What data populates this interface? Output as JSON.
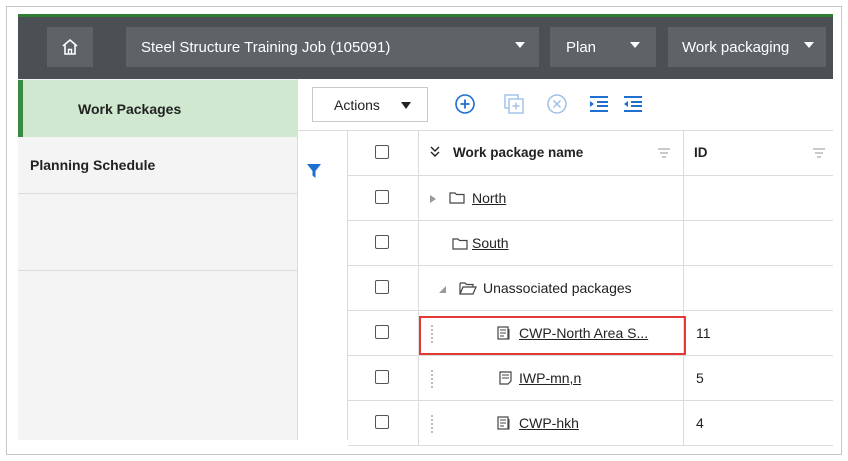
{
  "topbar": {
    "home_icon": "home-icon",
    "job_label": "Steel Structure Training Job (105091)",
    "plan_label": "Plan",
    "work_packaging_label": "Work packaging"
  },
  "sidebar": {
    "items": [
      {
        "label": "Work Packages",
        "active": true
      },
      {
        "label": "Planning Schedule",
        "active": false
      }
    ]
  },
  "toolbar": {
    "actions_label": "Actions",
    "icons": [
      "add-icon",
      "add-child-icon",
      "remove-icon",
      "indent-icon",
      "outdent-icon"
    ]
  },
  "grid": {
    "columns": [
      "Work package name",
      "ID"
    ],
    "rows": [
      {
        "name": "North",
        "id": "",
        "type": "folder",
        "expanded": false
      },
      {
        "name": "South",
        "id": "",
        "type": "folder"
      },
      {
        "name": "Unassociated packages",
        "id": "",
        "type": "folder-open",
        "expanded": true
      },
      {
        "name": "CWP-North Area S...",
        "id": "11",
        "type": "cwp"
      },
      {
        "name": "IWP-mn,n",
        "id": "5",
        "type": "iwp"
      },
      {
        "name": "CWP-hkh",
        "id": "4",
        "type": "cwp"
      }
    ]
  },
  "colors": {
    "topbar": "#4b5055",
    "accent_green": "#3a8a46",
    "active_bg": "#cfe8cf",
    "icon_blue": "#1f6fd1",
    "highlight_red": "#e53935"
  }
}
